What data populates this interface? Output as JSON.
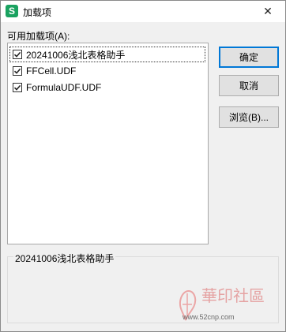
{
  "window": {
    "title": "加载项",
    "app_icon_letter": "S",
    "close_glyph": "✕"
  },
  "available_label": "可用加载项(A):",
  "items": [
    {
      "label": "20241006浅北表格助手",
      "checked": true
    },
    {
      "label": "FFCell.UDF",
      "checked": true
    },
    {
      "label": "FormulaUDF.UDF",
      "checked": true
    }
  ],
  "buttons": {
    "ok": "确定",
    "cancel": "取消",
    "browse": "浏览(B)..."
  },
  "group": {
    "title": "20241006浅北表格助手"
  },
  "watermark": {
    "text": "華印社區",
    "site": "www.52cnp.com"
  }
}
